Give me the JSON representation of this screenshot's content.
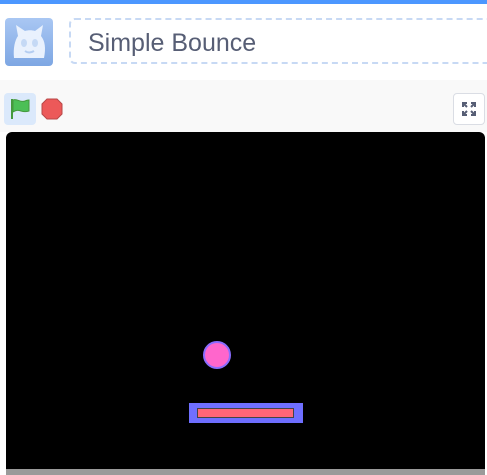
{
  "project": {
    "title": "Simple Bounce"
  },
  "icons": {
    "avatar": "cat-icon",
    "green_flag": "green-flag-icon",
    "stop": "stop-icon",
    "fullscreen": "fullscreen-icon"
  },
  "colors": {
    "accent": "#4c97ff",
    "stage_background": "#000000",
    "ball": "#ff66cc",
    "ball_outline": "#8a6cff",
    "paddle_outline": "#6f6fff",
    "paddle_fill": "#ff6677",
    "flag": "#4cbf56",
    "stop": "#ec5959"
  }
}
